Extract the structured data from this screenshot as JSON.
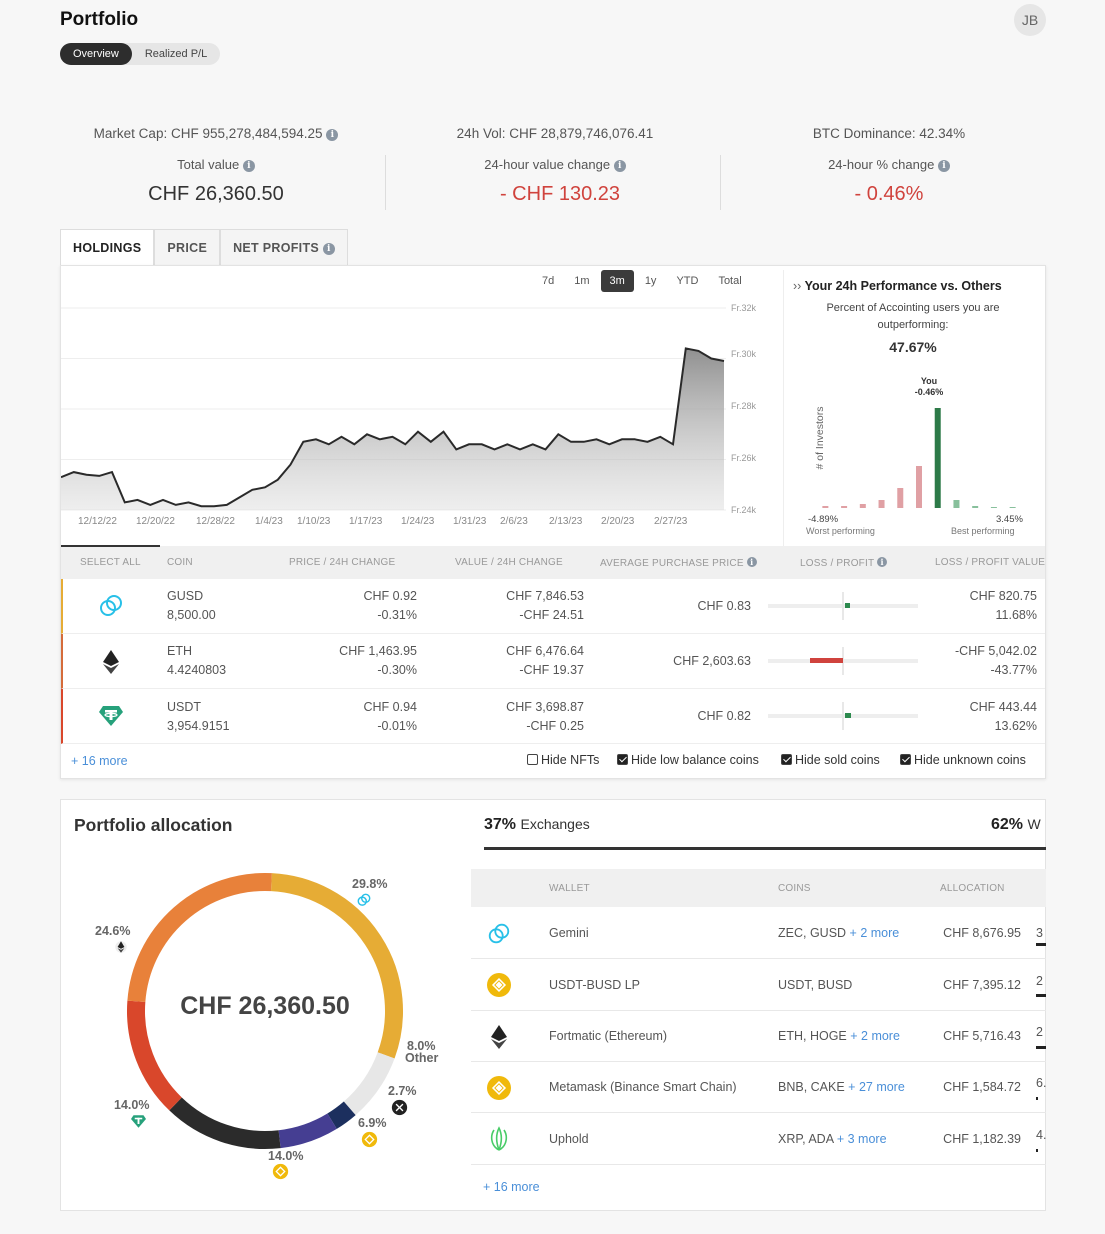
{
  "header": {
    "title": "Portfolio",
    "avatar": "JB",
    "tabs": [
      "Overview",
      "Realized P/L"
    ]
  },
  "market": {
    "cap": "Market Cap: CHF 955,278,484,594.25",
    "vol": "24h Vol: CHF 28,879,746,076.41",
    "btc": "BTC Dominance: 42.34%"
  },
  "stats": {
    "total_label": "Total value",
    "total": "CHF 26,360.50",
    "change_label": "24-hour value change",
    "change": "- CHF 130.23",
    "pct_label": "24-hour % change",
    "pct": "- 0.46%"
  },
  "chart_tabs": [
    "HOLDINGS",
    "PRICE",
    "NET PROFITS"
  ],
  "ranges": [
    "7d",
    "1m",
    "3m",
    "1y",
    "YTD",
    "Total"
  ],
  "chart_data": {
    "type": "area",
    "x": [
      "12/12/22",
      "12/20/22",
      "12/28/22",
      "1/4/23",
      "1/10/23",
      "1/17/23",
      "1/24/23",
      "1/31/23",
      "2/6/23",
      "2/13/23",
      "2/20/23",
      "2/27/23"
    ],
    "yticks": [
      "Fr.32k",
      "Fr.30k",
      "Fr.28k",
      "Fr.26k",
      "Fr.24k"
    ],
    "ylim": [
      24000,
      32000
    ],
    "values": [
      25300,
      25500,
      25400,
      25350,
      25500,
      24300,
      24400,
      24200,
      24400,
      24200,
      24300,
      24150,
      24150,
      24200,
      24500,
      24800,
      24900,
      25200,
      25800,
      26700,
      26800,
      26600,
      26900,
      26600,
      27000,
      26800,
      26900,
      26600,
      27100,
      26700,
      27100,
      26400,
      26600,
      26600,
      26400,
      26600,
      26400,
      26600,
      26400,
      27000,
      26700,
      26700,
      26800,
      26600,
      26800,
      26800,
      26700,
      26900,
      26600,
      30400,
      30300,
      30000,
      29900
    ]
  },
  "perf": {
    "title": "Your 24h Performance vs. Others",
    "sub": "Percent of Accointing users you are outperforming:",
    "value": "47.67%",
    "ylabel": "# of Investors",
    "you_label": "You",
    "you_value": "-0.46%",
    "min": "-4.89%",
    "min_label": "Worst performing",
    "max": "3.45%",
    "max_label": "Best performing",
    "bars": [
      2,
      2,
      4,
      8,
      20,
      42,
      100,
      8,
      2,
      1,
      1
    ],
    "you_index": 6
  },
  "table": {
    "headers": [
      "SELECT ALL",
      "COIN",
      "PRICE / 24H CHANGE",
      "VALUE / 24H CHANGE",
      "AVERAGE PURCHASE PRICE",
      "LOSS / PROFIT",
      "LOSS / PROFIT VALUE"
    ],
    "rows": [
      {
        "coin": "GUSD",
        "amount": "8,500.00",
        "price": "CHF 0.92",
        "pchg": "-0.31%",
        "value": "CHF 7,846.53",
        "vchg": "-CHF 24.51",
        "avg": "CHF 0.83",
        "pl": "CHF 820.75",
        "plpct": "11.68%",
        "bar": 0.07
      },
      {
        "coin": "ETH",
        "amount": "4.4240803",
        "price": "CHF 1,463.95",
        "pchg": "-0.30%",
        "value": "CHF 6,476.64",
        "vchg": "-CHF 19.37",
        "avg": "CHF 2,603.63",
        "pl": "-CHF 5,042.02",
        "plpct": "-43.77%",
        "bar": -0.44
      },
      {
        "coin": "USDT",
        "amount": "3,954.9151",
        "price": "CHF 0.94",
        "pchg": "-0.01%",
        "value": "CHF 3,698.87",
        "vchg": "-CHF 0.25",
        "avg": "CHF 0.82",
        "pl": "CHF 443.44",
        "plpct": "13.62%",
        "bar": 0.08
      }
    ],
    "more": "+ 16 more",
    "options": [
      "Hide NFTs",
      "Hide low balance coins",
      "Hide sold coins",
      "Hide unknown coins"
    ]
  },
  "allocation": {
    "title": "Portfolio allocation",
    "total": "CHF 26,360.50",
    "labels": [
      "29.8%",
      "24.6%",
      "14.0%",
      "14.0%",
      "6.9%",
      "2.7%",
      "8.0%",
      "Other"
    ],
    "slices": [
      29.8,
      8.0,
      2.7,
      6.9,
      14.0,
      14.0,
      24.6
    ],
    "colors": [
      "#e6ac35",
      "#e7e7e7",
      "#1c2f5e",
      "#453e92",
      "#2b2b2b",
      "#d9472b",
      "#e8813a"
    ]
  },
  "wallets": {
    "tab1_pct": "37%",
    "tab1": "Exchanges",
    "tab2_pct": "62%",
    "tab2": "W",
    "headers": [
      "WALLET",
      "COINS",
      "ALLOCATION"
    ],
    "rows": [
      {
        "name": "Gemini",
        "coins": "ZEC, GUSD",
        "more": "+ 2 more",
        "alloc": "CHF 8,676.95",
        "pct": "3"
      },
      {
        "name": "USDT-BUSD LP",
        "coins": "USDT, BUSD",
        "more": "",
        "alloc": "CHF 7,395.12",
        "pct": "2"
      },
      {
        "name": "Fortmatic (Ethereum)",
        "coins": "ETH, HOGE",
        "more": "+ 2 more",
        "alloc": "CHF 5,716.43",
        "pct": "2"
      },
      {
        "name": "Metamask (Binance Smart Chain)",
        "coins": "BNB, CAKE",
        "more": "+ 27 more",
        "alloc": "CHF 1,584.72",
        "pct": "6."
      },
      {
        "name": "Uphold",
        "coins": "XRP, ADA",
        "more": "+ 3 more",
        "alloc": "CHF 1,182.39",
        "pct": "4."
      }
    ],
    "more": "+ 16 more"
  },
  "colors": {
    "red": "#d0433d",
    "green": "#2d8a4e",
    "link": "#4a8fd8",
    "gemini": "#28c0e8",
    "binance": "#f0b90b",
    "tether": "#26a17b"
  }
}
